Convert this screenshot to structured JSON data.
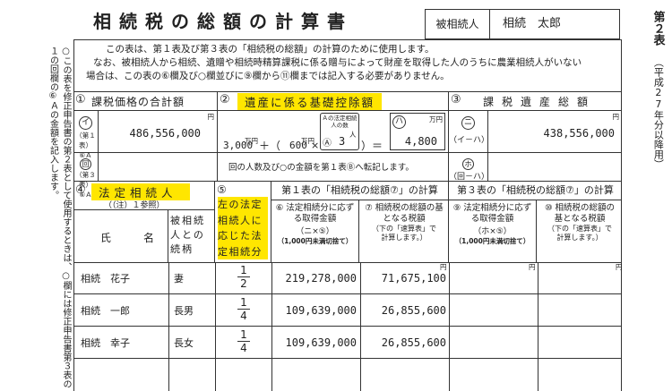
{
  "form": {
    "title": "相続税の総額の計算書",
    "decedent_label": "被相続人",
    "decedent_name": "相続　太郎",
    "table_number": "第２表",
    "version_note": "（平成27年分以降用）",
    "left_note": "○この表を修正申告書の第２表として使用するときは、○欄には修正申告書第３表の１の回欄の⑥Ａの金額を記入します。",
    "intro_lines": [
      "この表は、第１表及び第３表の「相続税の総額」の計算のために使用します。",
      "なお、被相続人から相続、遺贈や相続時精算課税に係る贈与によって財産を取得した人のうちに農業相続人がいない",
      "場合は、この表の⑥欄及び○欄並びに⑨欄から⑪欄までは記入する必要がありません。"
    ]
  },
  "sec1": {
    "num": "①",
    "title": "課税価格の合計額",
    "row1_circle": "イ",
    "row1_label_a": "（第１表）",
    "row1_label_b": "⑥Ａ",
    "row1_value": "486,556,000",
    "row2_circle": "回",
    "row2_label_a": "（第３表）",
    "row2_label_b": "⑥Ａ",
    "unit_yen": "円"
  },
  "sec2": {
    "num": "②",
    "title": "遺産に係る基礎控除額",
    "base": "3,000",
    "unit_man": "万円",
    "plus": "＋（",
    "coef": "600",
    "times": "×",
    "count_label": "Ａの法定相続人の数",
    "count_circle": "Ⓐ",
    "heirs": "3",
    "unit_nin": "人",
    "equals": "）＝",
    "result_circle": "ハ",
    "result": "4,800",
    "note": "回の人数及び○の金額を第１表Ⓑへ転記します。"
  },
  "sec3": {
    "num": "③",
    "title": "課税遺産総額",
    "row1_circle": "ニ",
    "row1_formula": "（イ－ハ）",
    "row1_value": "438,556,000",
    "row2_circle": "ホ",
    "row2_formula": "（回－ハ）",
    "unit_yen": "円"
  },
  "sec4": {
    "num": "④",
    "title": "法定相続人",
    "note": "（（注）１参照）",
    "col_name": "氏　　　名",
    "col_relation": "被相続人との続柄",
    "sec5_num": "⑤",
    "sec5_title": "左の法定相続人に応じた法定相続分"
  },
  "calc1": {
    "header": "第１表の「相続税の総額⑦」の計算",
    "col6_title": "⑥ 法定相続分に応ずる取得金額",
    "col6_formula": "（ニ×⑤）",
    "col6_note": "（1,000円未満切捨て）",
    "col7_title": "⑦ 相続税の総額の基となる税額",
    "col7_note": "（下の「速算表」で計算します。）"
  },
  "calc3": {
    "header": "第３表の「相続税の総額⑦」の計算",
    "col9_title": "⑨ 法定相続分に応ずる取得金額",
    "col9_formula": "（ホ×⑤）",
    "col9_note": "（1,000円未満切捨て）",
    "col10_title": "⑩ 相続税の総額の基となる税額",
    "col10_note": "（下の「速算表」で計算します。）"
  },
  "rows": [
    {
      "name": "相続　花子",
      "relation": "妻",
      "share_num": "1",
      "share_den": "2",
      "acq": "219,278,000",
      "tax": "71,675,100"
    },
    {
      "name": "相続　一郎",
      "relation": "長男",
      "share_num": "1",
      "share_den": "4",
      "acq": "109,639,000",
      "tax": "26,855,600"
    },
    {
      "name": "相続　幸子",
      "relation": "長女",
      "share_num": "1",
      "share_den": "4",
      "acq": "109,639,000",
      "tax": "26,855,600"
    }
  ]
}
